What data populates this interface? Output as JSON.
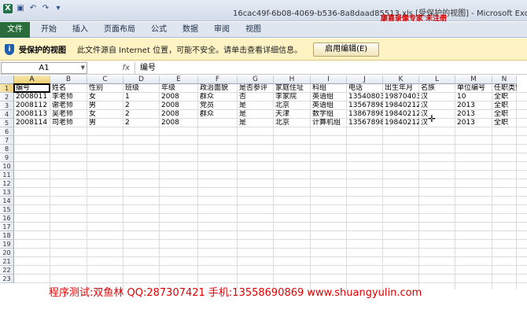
{
  "window": {
    "title": "16cac49f-6b08-4069-b536-8a8daad85513.xls  [受保护的视图] - Microsoft Excel",
    "watermark_top": "康喜录像专家 未注册"
  },
  "ribbon": {
    "tabs": [
      "文件",
      "开始",
      "插入",
      "页面布局",
      "公式",
      "数据",
      "审阅",
      "视图"
    ]
  },
  "protected_view": {
    "title": "受保护的视图",
    "message": "此文件源自 Internet 位置，可能不安全。请单击查看详细信息。",
    "enable_button": "启用编辑(E)"
  },
  "formula_bar": {
    "name_box": "A1",
    "fx": "fx",
    "content": "编号"
  },
  "sheet": {
    "columns": [
      "A",
      "B",
      "C",
      "D",
      "E",
      "F",
      "G",
      "H",
      "I",
      "J",
      "K",
      "L",
      "M",
      "N"
    ],
    "rows": [
      "1",
      "2",
      "3",
      "4",
      "5",
      "6",
      "7",
      "8",
      "9",
      "10",
      "11",
      "12",
      "13",
      "14",
      "15",
      "16",
      "17",
      "18",
      "19",
      "20",
      "21",
      "22",
      "23"
    ],
    "header_row": [
      "编号",
      "姓名",
      "性别",
      "班级",
      "年级",
      "政治面貌",
      "是否参评",
      "家庭住址",
      "科组",
      "电话",
      "出生年月",
      "名族",
      "单位编号",
      "任职类型"
    ],
    "data": [
      [
        "2008011",
        "李老师",
        "女",
        "1",
        "2008",
        "群众",
        "否",
        "李家院",
        "英语组",
        "13540803",
        "19870403",
        "汉",
        "10",
        "全职"
      ],
      [
        "2008112",
        "谢老师",
        "男",
        "2",
        "2008",
        "党员",
        "是",
        "北京",
        "英语组",
        "13567898",
        "19840212",
        "汉",
        "2013",
        "全职"
      ],
      [
        "2008113",
        "吴老师",
        "女",
        "2",
        "2008",
        "群众",
        "是",
        "天津",
        "数学组",
        "13867898",
        "19840212",
        "汉",
        "2013",
        "全职"
      ],
      [
        "2008114",
        "司老师",
        "男",
        "2",
        "2008",
        "",
        "是",
        "北京",
        "计算机组",
        "13567898",
        "19840212",
        "汉",
        "2013",
        "全职"
      ]
    ]
  },
  "watermark_bottom": "程序测试:双鱼林 QQ:287307421 手机:13558690869 www.shuangyulin.com"
}
